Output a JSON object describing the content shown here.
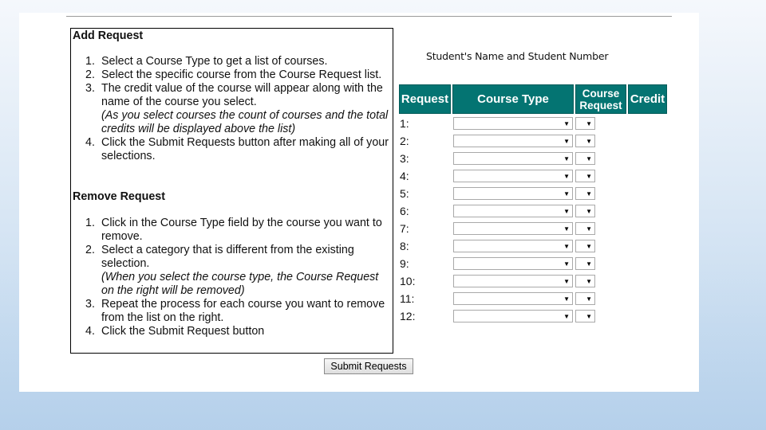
{
  "form": {
    "add_title": "Add Request",
    "add_steps": [
      {
        "num": "1.",
        "text": "Select a Course Type to get a list of courses.",
        "note": ""
      },
      {
        "num": "2.",
        "text": "Select the specific course from the Course Request list.",
        "note": ""
      },
      {
        "num": "3.",
        "text": "The credit value of the course will appear along with the name of the course you select.",
        "note": "(As you select courses the count of courses and the total credits will be displayed above the list)"
      },
      {
        "num": "4.",
        "text": "Click the Submit Requests button after making all of your selections.",
        "note": ""
      }
    ],
    "remove_title": "Remove Request",
    "remove_steps": [
      {
        "num": "1.",
        "text": "Click in the Course Type field by the course you want to remove.",
        "note": ""
      },
      {
        "num": "2.",
        "text": "Select a category that is different from the existing selection.",
        "note": "(When you select the course type, the Course Request on the right will be removed)"
      },
      {
        "num": "3.",
        "text": "Repeat the process for each course you want to remove from the list on the right.",
        "note": ""
      },
      {
        "num": "4.",
        "text": "Click the Submit Request button",
        "note": ""
      }
    ],
    "student_label": "Student's Name and Student Number",
    "table_headers": {
      "request": "Request",
      "course_type": "Course Type",
      "course_request": "Course Request",
      "credit": "Credit"
    },
    "rows": [
      "1:",
      "2:",
      "3:",
      "4:",
      "5:",
      "6:",
      "7:",
      "8:",
      "9:",
      "10:",
      "11:",
      "12:"
    ],
    "dropdown_arrow_icon": "triangle-down-icon",
    "submit_label": "Submit Requests"
  },
  "colors": {
    "header_bg": "#047472",
    "header_text": "#ffffff"
  }
}
